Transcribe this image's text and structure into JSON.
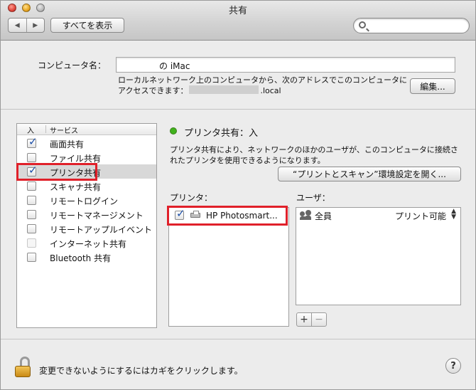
{
  "window": {
    "title": "共有"
  },
  "toolbar": {
    "back_glyph": "◀",
    "forward_glyph": "▶",
    "show_all_label": "すべてを表示",
    "search_placeholder": ""
  },
  "computer_name": {
    "label": "コンピュータ名：",
    "value": "の iMac",
    "description_line1": "ローカルネットワーク上のコンピュータから、次のアドレスでこのコンピュータに",
    "description_line2_prefix": "アクセスできます：",
    "description_line2_suffix": ".local",
    "edit_button": "編集..."
  },
  "services": {
    "header_on": "入",
    "header_service": "サービス",
    "items": [
      {
        "label": "画面共有",
        "checked": true,
        "enabled": true
      },
      {
        "label": "ファイル共有",
        "checked": false,
        "enabled": true
      },
      {
        "label": "プリンタ共有",
        "checked": true,
        "enabled": true,
        "selected": true
      },
      {
        "label": "スキャナ共有",
        "checked": false,
        "enabled": true
      },
      {
        "label": "リモートログイン",
        "checked": false,
        "enabled": true
      },
      {
        "label": "リモートマネージメント",
        "checked": false,
        "enabled": true
      },
      {
        "label": "リモートアップルイベント",
        "checked": false,
        "enabled": true
      },
      {
        "label": "インターネット共有",
        "checked": false,
        "enabled": false
      },
      {
        "label": "Bluetooth 共有",
        "checked": false,
        "enabled": true
      }
    ]
  },
  "detail": {
    "status": "プリンタ共有：入",
    "status_color": "#40b21c",
    "description_line1": "プリンタ共有により、ネットワークのほかのユーザが、このコンピュータに接続さ",
    "description_line2": "れたプリンタを使用できるようになります。",
    "open_prefs_button": "“プリントとスキャン”環境設定を開く...",
    "printers_label": "プリンタ：",
    "users_label": "ユーザ：",
    "printers": [
      {
        "name": "HP Photosmart...",
        "checked": true
      }
    ],
    "users": [
      {
        "name": "全員",
        "permission": "プリント可能"
      }
    ],
    "add_label": "+",
    "remove_label": "−"
  },
  "footer": {
    "lock_text": "変更できないようにするにはカギをクリックします。",
    "help_label": "?"
  },
  "highlight_color": "#e0202a"
}
